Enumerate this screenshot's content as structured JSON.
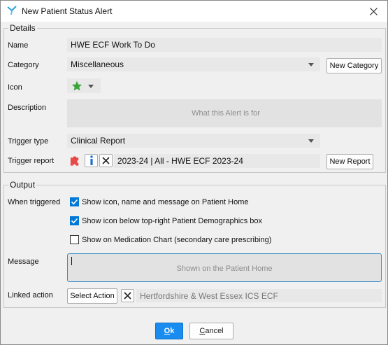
{
  "window": {
    "title": "New Patient Status Alert",
    "app_icon": "y-logo-icon",
    "close_icon": "close-icon"
  },
  "details": {
    "legend": "Details",
    "name_label": "Name",
    "name_value": "HWE ECF Work To Do",
    "category_label": "Category",
    "category_value": "Miscellaneous",
    "new_category_button": "New Category",
    "icon_label": "Icon",
    "icon_value": "green-star-icon",
    "description_label": "Description",
    "description_placeholder": "What this Alert is for",
    "trigger_type_label": "Trigger type",
    "trigger_type_value": "Clinical Report",
    "trigger_report_label": "Trigger report",
    "trigger_report_value": "2023-24 |  All - HWE ECF 2023-24",
    "new_report_button": "New Report"
  },
  "output": {
    "legend": "Output",
    "when_triggered_label": "When triggered",
    "options": [
      {
        "label": "Show icon, name and message on Patient Home",
        "checked": true
      },
      {
        "label": "Show icon below top-right Patient Demographics box",
        "checked": true
      },
      {
        "label": "Show on Medication Chart (secondary care prescribing)",
        "checked": false
      }
    ],
    "message_label": "Message",
    "message_placeholder": "Shown on the Patient Home",
    "linked_action_label": "Linked action",
    "select_action_button": "Select Action",
    "linked_action_value": "Hertfordshire & West Essex ICS ECF"
  },
  "footer": {
    "ok_label": "Ok",
    "cancel_label": "Cancel"
  },
  "colors": {
    "accent": "#1a8cef",
    "checkbox_checked": "#0078d7",
    "star": "#3aa63a",
    "info": "#1e6fd0",
    "puzzle": "#e84a4a"
  }
}
